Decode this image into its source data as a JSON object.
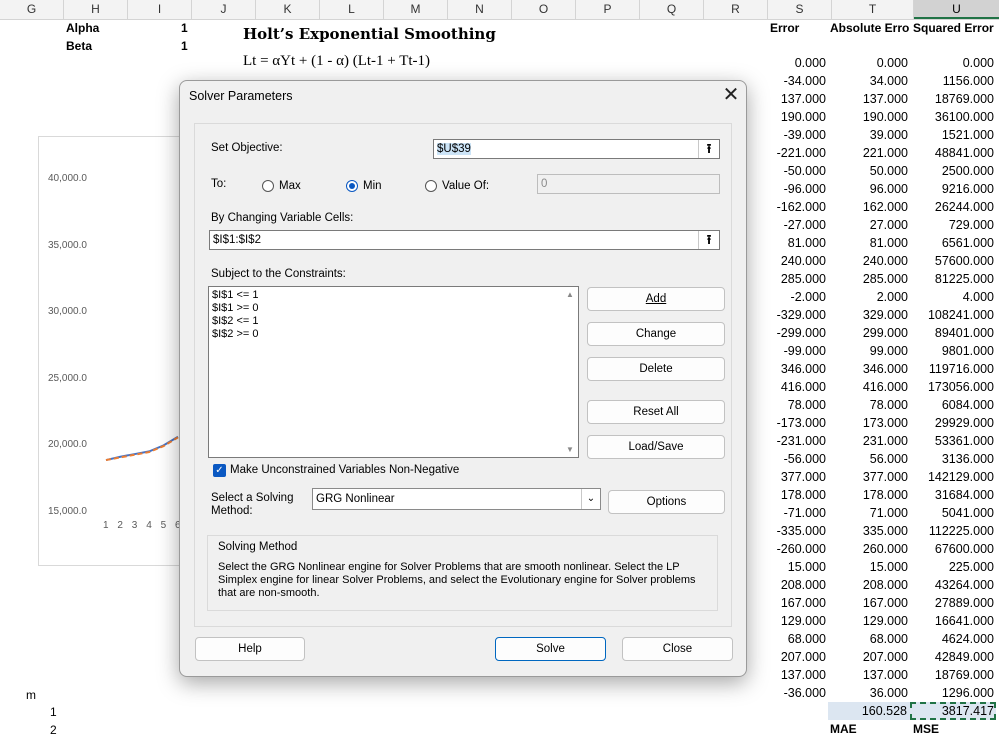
{
  "sheet": {
    "columns": [
      "G",
      "H",
      "I",
      "J",
      "K",
      "L",
      "M",
      "N",
      "O",
      "P",
      "Q",
      "R",
      "S",
      "T",
      "U"
    ],
    "selected_column": "U",
    "params": [
      {
        "label": "Alpha",
        "value": "1"
      },
      {
        "label": "Beta",
        "value": "1"
      }
    ],
    "title": "Holt’s Exponential Smoothing",
    "formula": "Lt = αYt + (1 - α) (Lt-1 + Tt-1)",
    "headers": {
      "error": "Error",
      "abs_error": "Absolute Erro",
      "sq_error": "Squared Error"
    },
    "rows": [
      {
        "error": "0.000",
        "abs": "0.000",
        "sq": "0.000"
      },
      {
        "error": "-34.000",
        "abs": "34.000",
        "sq": "1156.000"
      },
      {
        "error": "137.000",
        "abs": "137.000",
        "sq": "18769.000"
      },
      {
        "error": "190.000",
        "abs": "190.000",
        "sq": "36100.000"
      },
      {
        "error": "-39.000",
        "abs": "39.000",
        "sq": "1521.000"
      },
      {
        "error": "-221.000",
        "abs": "221.000",
        "sq": "48841.000"
      },
      {
        "error": "-50.000",
        "abs": "50.000",
        "sq": "2500.000"
      },
      {
        "error": "-96.000",
        "abs": "96.000",
        "sq": "9216.000"
      },
      {
        "error": "-162.000",
        "abs": "162.000",
        "sq": "26244.000"
      },
      {
        "error": "-27.000",
        "abs": "27.000",
        "sq": "729.000"
      },
      {
        "error": "81.000",
        "abs": "81.000",
        "sq": "6561.000"
      },
      {
        "error": "240.000",
        "abs": "240.000",
        "sq": "57600.000"
      },
      {
        "error": "285.000",
        "abs": "285.000",
        "sq": "81225.000"
      },
      {
        "error": "-2.000",
        "abs": "2.000",
        "sq": "4.000"
      },
      {
        "error": "-329.000",
        "abs": "329.000",
        "sq": "108241.000"
      },
      {
        "error": "-299.000",
        "abs": "299.000",
        "sq": "89401.000"
      },
      {
        "error": "-99.000",
        "abs": "99.000",
        "sq": "9801.000"
      },
      {
        "error": "346.000",
        "abs": "346.000",
        "sq": "119716.000"
      },
      {
        "error": "416.000",
        "abs": "416.000",
        "sq": "173056.000"
      },
      {
        "error": "78.000",
        "abs": "78.000",
        "sq": "6084.000"
      },
      {
        "error": "-173.000",
        "abs": "173.000",
        "sq": "29929.000"
      },
      {
        "error": "-231.000",
        "abs": "231.000",
        "sq": "53361.000"
      },
      {
        "error": "-56.000",
        "abs": "56.000",
        "sq": "3136.000"
      },
      {
        "error": "377.000",
        "abs": "377.000",
        "sq": "142129.000"
      },
      {
        "error": "178.000",
        "abs": "178.000",
        "sq": "31684.000"
      },
      {
        "error": "-71.000",
        "abs": "71.000",
        "sq": "5041.000"
      },
      {
        "error": "-335.000",
        "abs": "335.000",
        "sq": "112225.000"
      },
      {
        "error": "-260.000",
        "abs": "260.000",
        "sq": "67600.000"
      },
      {
        "error": "15.000",
        "abs": "15.000",
        "sq": "225.000"
      },
      {
        "error": "208.000",
        "abs": "208.000",
        "sq": "43264.000"
      },
      {
        "error": "167.000",
        "abs": "167.000",
        "sq": "27889.000"
      },
      {
        "error": "129.000",
        "abs": "129.000",
        "sq": "16641.000"
      },
      {
        "error": "68.000",
        "abs": "68.000",
        "sq": "4624.000"
      },
      {
        "error": "207.000",
        "abs": "207.000",
        "sq": "42849.000"
      },
      {
        "error": "137.000",
        "abs": "137.000",
        "sq": "18769.000"
      },
      {
        "error": "-36.000",
        "abs": "36.000",
        "sq": "1296.000"
      }
    ],
    "mae_value": "160.528",
    "mse_value": "3817.417",
    "mae_label": "MAE",
    "mse_label": "MSE",
    "side_labels": {
      "m": "m",
      "one": "1",
      "two": "2"
    }
  },
  "chart_data": {
    "type": "line",
    "y_ticks": [
      "40,000.0",
      "35,000.0",
      "30,000.0",
      "25,000.0",
      "20,000.0",
      "15,000.0"
    ],
    "ylim": [
      15000,
      40000
    ],
    "x_ticks": [
      "1",
      "2",
      "3",
      "4",
      "5",
      "6"
    ],
    "series": [
      {
        "values": [
          18900,
          19150,
          19350,
          19550,
          20000,
          20650
        ],
        "color": "#4472c4"
      },
      {
        "values": [
          18900,
          19100,
          19300,
          19500,
          19950,
          20600
        ],
        "color": "#ed7d31"
      }
    ]
  },
  "dialog": {
    "title": "Solver Parameters",
    "set_objective_label": "Set Objective:",
    "objective_value": "$U$39",
    "to_label": "To:",
    "radio_max": "Max",
    "radio_min": "Min",
    "radio_value_of": "Value Of:",
    "value_of_value": "0",
    "selected_radio": "Min",
    "changing_cells_label": "By Changing Variable Cells:",
    "changing_cells_value": "$I$1:$I$2",
    "constraints_label": "Subject to the Constraints:",
    "constraints": [
      "$I$1 <= 1",
      "$I$1 >= 0",
      "$I$2 <= 1",
      "$I$2 >= 0"
    ],
    "buttons": {
      "add": "Add",
      "change": "Change",
      "delete": "Delete",
      "reset_all": "Reset All",
      "load_save": "Load/Save",
      "options": "Options",
      "help": "Help",
      "solve": "Solve",
      "close": "Close"
    },
    "nonnegative_label": "Make Unconstrained Variables Non-Negative",
    "nonnegative_checked": true,
    "method_label_line1": "Select a Solving",
    "method_label_line2": "Method:",
    "method_value": "GRG Nonlinear",
    "solving_method_title": "Solving Method",
    "solving_method_desc": "Select the GRG Nonlinear engine for Solver Problems that are smooth nonlinear. Select the LP Simplex engine for linear Solver Problems, and select the Evolutionary engine for Solver problems that are non-smooth."
  }
}
